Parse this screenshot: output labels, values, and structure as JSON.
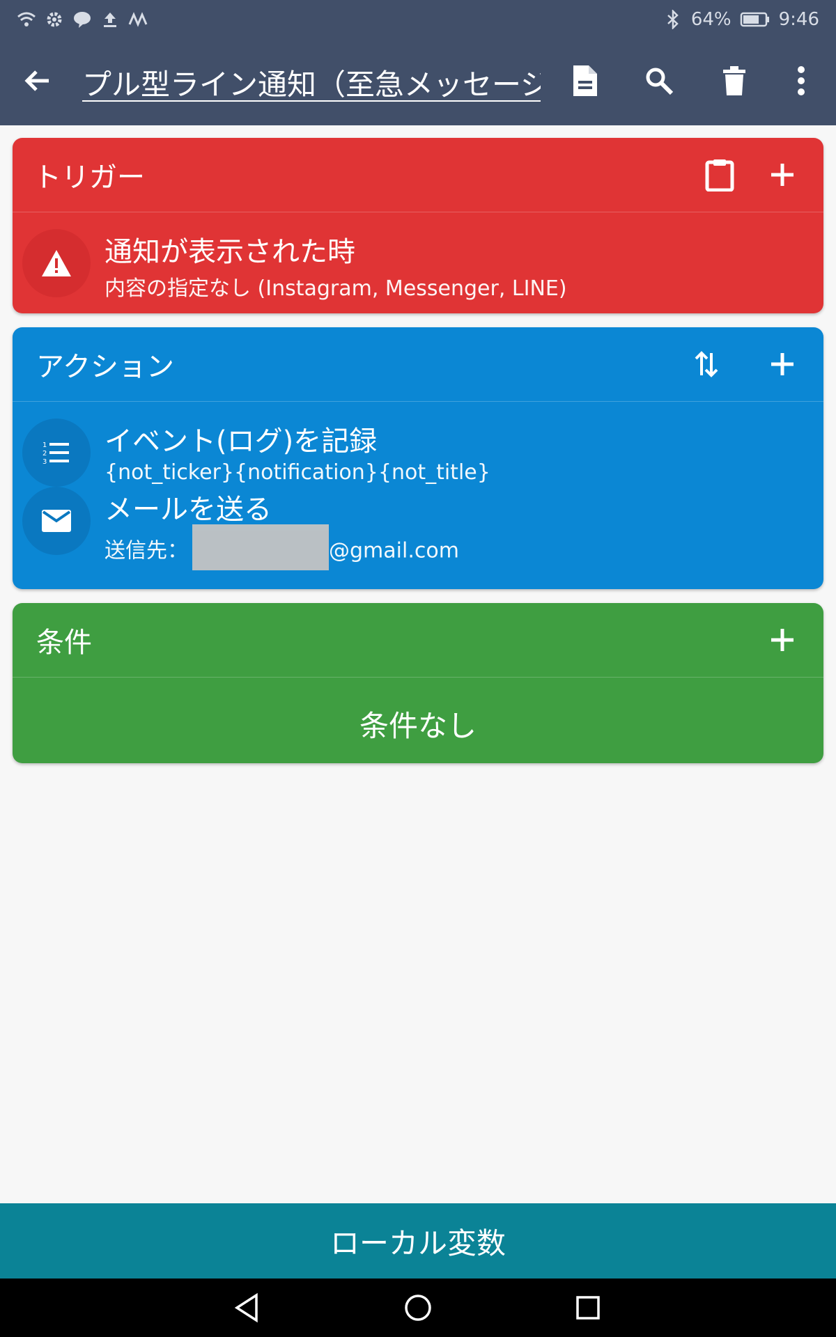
{
  "status_bar": {
    "battery": "64%",
    "time": "9:46",
    "left_icons": [
      "wifi-icon",
      "gear-icon",
      "line-icon",
      "upload-icon",
      "m-icon"
    ],
    "right_icons": [
      "bluetooth-icon",
      "battery-icon"
    ]
  },
  "app_bar": {
    "title_value": "プル型ライン通知（至急メッセージ",
    "actions": [
      "document-icon",
      "search-icon",
      "delete-icon",
      "more-icon"
    ]
  },
  "trigger": {
    "header": "トリガー",
    "items": [
      {
        "title": "通知が表示された時",
        "subtitle": "内容の指定なし (Instagram, Messenger, LINE)",
        "icon": "warning-icon"
      }
    ]
  },
  "actions": {
    "header": "アクション",
    "items": [
      {
        "title": "イベント(ログ)を記録",
        "subtitle": "{not_ticker}{notification}{not_title}",
        "icon": "numbered-list-icon"
      },
      {
        "title": "メールを送る",
        "subtitle_prefix": "送信先：",
        "subtitle_suffix": "@gmail.com",
        "icon": "mail-icon"
      }
    ]
  },
  "conditions": {
    "header": "条件",
    "empty_text": "条件なし"
  },
  "local_vars_button": "ローカル変数",
  "colors": {
    "appbar": "#414f69",
    "trigger": "#e03435",
    "actions": "#0b87d4",
    "conditions": "#3f9e41",
    "local_vars": "#0b8396"
  }
}
